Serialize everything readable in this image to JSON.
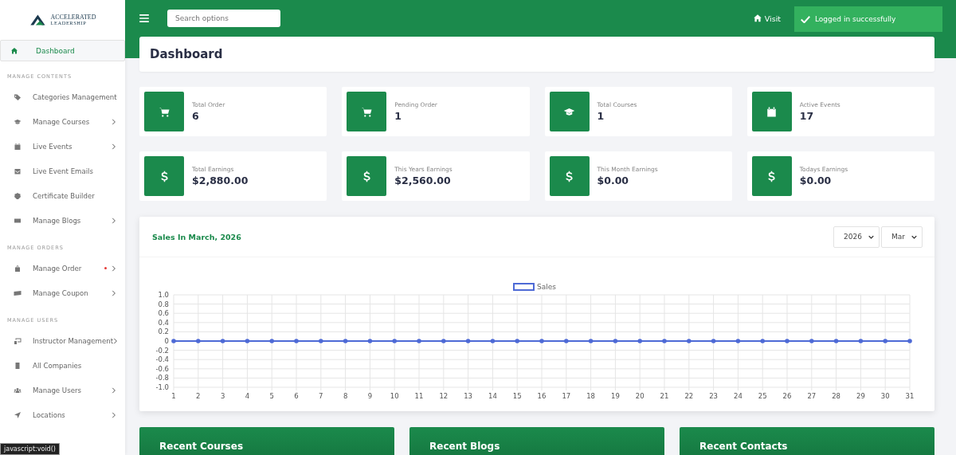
{
  "sidebar": {
    "logo": {
      "line1": "ACCELERATED",
      "line2": "LEADERSHIP"
    },
    "sections": [
      {
        "items": [
          {
            "label": "Dashboard",
            "selected": true,
            "chevron": false,
            "badge": false
          }
        ]
      },
      {
        "heading": "MANAGE CONTENTS",
        "items": [
          {
            "label": "Categories Management",
            "selected": false,
            "chevron": false,
            "badge": false
          },
          {
            "label": "Manage Courses",
            "selected": false,
            "chevron": true,
            "badge": false
          },
          {
            "label": "Live Events",
            "selected": false,
            "chevron": true,
            "badge": false
          },
          {
            "label": "Live Event Emails",
            "selected": false,
            "chevron": false,
            "badge": false
          },
          {
            "label": "Certificate Builder",
            "selected": false,
            "chevron": false,
            "badge": false
          },
          {
            "label": "Manage Blogs",
            "selected": false,
            "chevron": true,
            "badge": false
          }
        ]
      },
      {
        "heading": "MANAGE ORDERS",
        "items": [
          {
            "label": "Manage Order",
            "selected": false,
            "chevron": true,
            "badge": true
          },
          {
            "label": "Manage Coupon",
            "selected": false,
            "chevron": true,
            "badge": false
          }
        ]
      },
      {
        "heading": "MANAGE USERS",
        "items": [
          {
            "label": "Instructor Management",
            "selected": false,
            "chevron": true,
            "badge": false
          },
          {
            "label": "All Companies",
            "selected": false,
            "chevron": false,
            "badge": false
          },
          {
            "label": "Manage Users",
            "selected": false,
            "chevron": true,
            "badge": false
          },
          {
            "label": "Locations",
            "selected": false,
            "chevron": true,
            "badge": false
          }
        ]
      }
    ]
  },
  "header": {
    "search": {
      "placeholder": "Search options"
    },
    "visit_link": "Visit",
    "toast": "Logged in successfully"
  },
  "page_title": "Dashboard",
  "stats": [
    {
      "label": "Total Order",
      "value": "6"
    },
    {
      "label": "Pending Order",
      "value": "1"
    },
    {
      "label": "Total Courses",
      "value": "1"
    },
    {
      "label": "Active Events",
      "value": "17"
    },
    {
      "label": "Total Earnings",
      "value": "$2,880.00"
    },
    {
      "label": "This Years Earnings",
      "value": "$2,560.00"
    },
    {
      "label": "This Month Earnings",
      "value": "$0.00"
    },
    {
      "label": "Todays Earnings",
      "value": "$0.00"
    }
  ],
  "sales": {
    "title": "Sales In March, 2026",
    "year": "2026",
    "month": "Mar",
    "chart_data": {
      "type": "line",
      "x": [
        1,
        2,
        3,
        4,
        5,
        6,
        7,
        8,
        9,
        10,
        11,
        12,
        13,
        14,
        15,
        16,
        17,
        18,
        19,
        20,
        21,
        22,
        23,
        24,
        25,
        26,
        27,
        28,
        29,
        30,
        31
      ],
      "series": [
        {
          "name": "Sales",
          "color": "#4e6ad6",
          "values": [
            0,
            0,
            0,
            0,
            0,
            0,
            0,
            0,
            0,
            0,
            0,
            0,
            0,
            0,
            0,
            0,
            0,
            0,
            0,
            0,
            0,
            0,
            0,
            0,
            0,
            0,
            0,
            0,
            0,
            0,
            0
          ]
        }
      ],
      "xlim": [
        1,
        31
      ],
      "ylim": [
        -1,
        1
      ],
      "grid": true,
      "yticks": [
        {
          "value": 1,
          "label": "1.0"
        },
        {
          "value": 0.8,
          "label": "0.8"
        },
        {
          "value": 0.6,
          "label": "0.6"
        },
        {
          "value": 0.4,
          "label": "0.4"
        },
        {
          "value": 0.2,
          "label": "0.2"
        },
        {
          "value": 0,
          "label": "0"
        },
        {
          "value": -0.2,
          "label": "-0.2"
        },
        {
          "value": -0.4,
          "label": "-0.4"
        },
        {
          "value": -0.6,
          "label": "-0.6"
        },
        {
          "value": -0.8,
          "label": "-0.8"
        },
        {
          "value": -1,
          "label": "-1.0"
        }
      ],
      "xticks": [
        1,
        2,
        3,
        4,
        5,
        6,
        7,
        8,
        9,
        10,
        11,
        12,
        13,
        14,
        15,
        16,
        17,
        18,
        19,
        20,
        21,
        22,
        23,
        24,
        25,
        26,
        27,
        28,
        29,
        30,
        31
      ]
    }
  },
  "recent_panels": [
    "Recent Courses",
    "Recent Blogs",
    "Recent Contacts"
  ],
  "status_bar": "javascript:void()"
}
